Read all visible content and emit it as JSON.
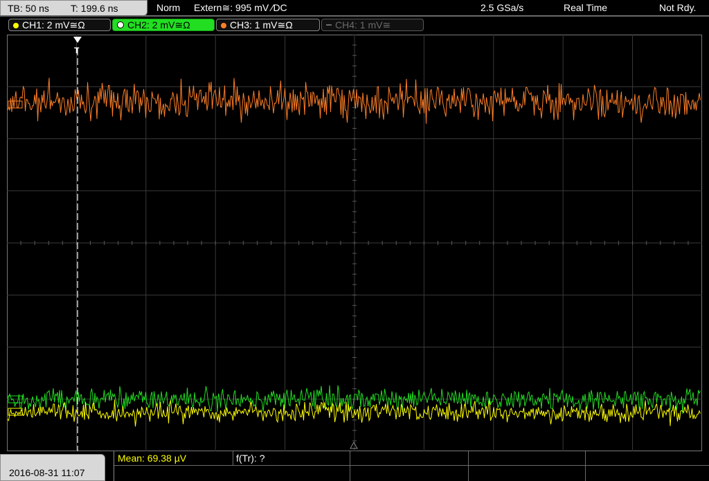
{
  "status_bar": {
    "timebase": "TB: 50 ns",
    "trigger_time": "T: 199.6 ns",
    "trigger_mode": "Norm",
    "trigger_source": "Extern≅: 995 mV ⁄DC",
    "sample_rate": "2.5 GSa/s",
    "acq_mode": "Real Time",
    "state": "Not Rdy."
  },
  "channels": [
    {
      "label": "CH1: 2 mV≅Ω",
      "color": "#ffff00",
      "active": false,
      "enabled": true
    },
    {
      "label": "CH2: 2 mV≅Ω",
      "color": "#22dd22",
      "active": true,
      "enabled": true
    },
    {
      "label": "CH3: 1 mV≅Ω",
      "color": "#ff7f27",
      "active": false,
      "enabled": true
    },
    {
      "label": "CH4: 1 mV≅",
      "color": "#6a6a6a",
      "active": false,
      "enabled": false
    }
  ],
  "trigger_marker": "T",
  "traces": {
    "ch3_color": "#ff7f27",
    "ch2_color": "#22dd22",
    "ch1_color": "#ffff00"
  },
  "footer": {
    "datetime": "2016-08-31 11:07",
    "measurement_1": "Mean: 69.38 µV",
    "measurement_2": "f(Tr): ?"
  }
}
